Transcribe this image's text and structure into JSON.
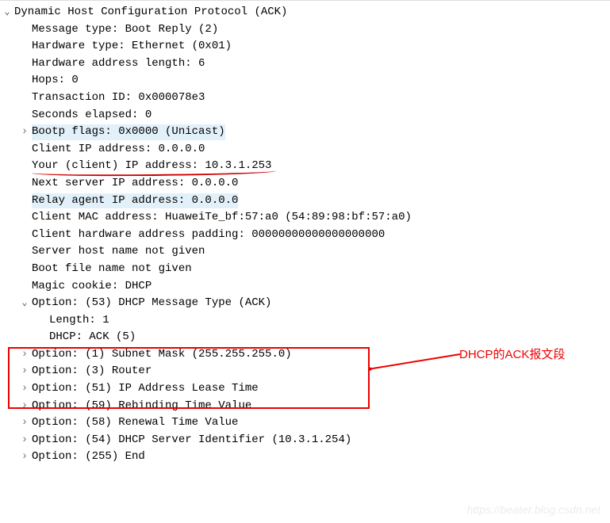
{
  "header": {
    "title": "Dynamic Host Configuration Protocol (ACK)"
  },
  "fields": {
    "message_type": "Message type: Boot Reply (2)",
    "hardware_type": "Hardware type: Ethernet (0x01)",
    "hw_addr_len": "Hardware address length: 6",
    "hops": "Hops: 0",
    "transaction_id": "Transaction ID: 0x000078e3",
    "seconds": "Seconds elapsed: 0",
    "bootp_flags": "Bootp flags: 0x0000 (Unicast)",
    "client_ip": "Client IP address: 0.0.0.0",
    "your_ip": "Your (client) IP address: 10.3.1.253",
    "next_server": "Next server IP address: 0.0.0.0",
    "relay_ip": "Relay agent IP address: 0.0.0.0",
    "client_mac": "Client MAC address: HuaweiTe_bf:57:a0 (54:89:98:bf:57:a0)",
    "padding": "Client hardware address padding: 00000000000000000000",
    "server_host": "Server host name not given",
    "boot_file": "Boot file name not given",
    "magic_cookie": "Magic cookie: DHCP"
  },
  "option53": {
    "title": "Option: (53) DHCP Message Type (ACK)",
    "length": "Length: 1",
    "dhcp": "DHCP: ACK (5)"
  },
  "options": {
    "opt1": "Option: (1) Subnet Mask (255.255.255.0)",
    "opt3": "Option: (3) Router",
    "opt51": "Option: (51) IP Address Lease Time",
    "opt59": "Option: (59) Rebinding Time Value",
    "opt58": "Option: (58) Renewal Time Value",
    "opt54": "Option: (54) DHCP Server Identifier (10.3.1.254)",
    "opt255": "Option: (255) End"
  },
  "annotation": {
    "text": "DHCP的ACK报文段"
  },
  "watermark": "https://beater.blog.csdn.net"
}
